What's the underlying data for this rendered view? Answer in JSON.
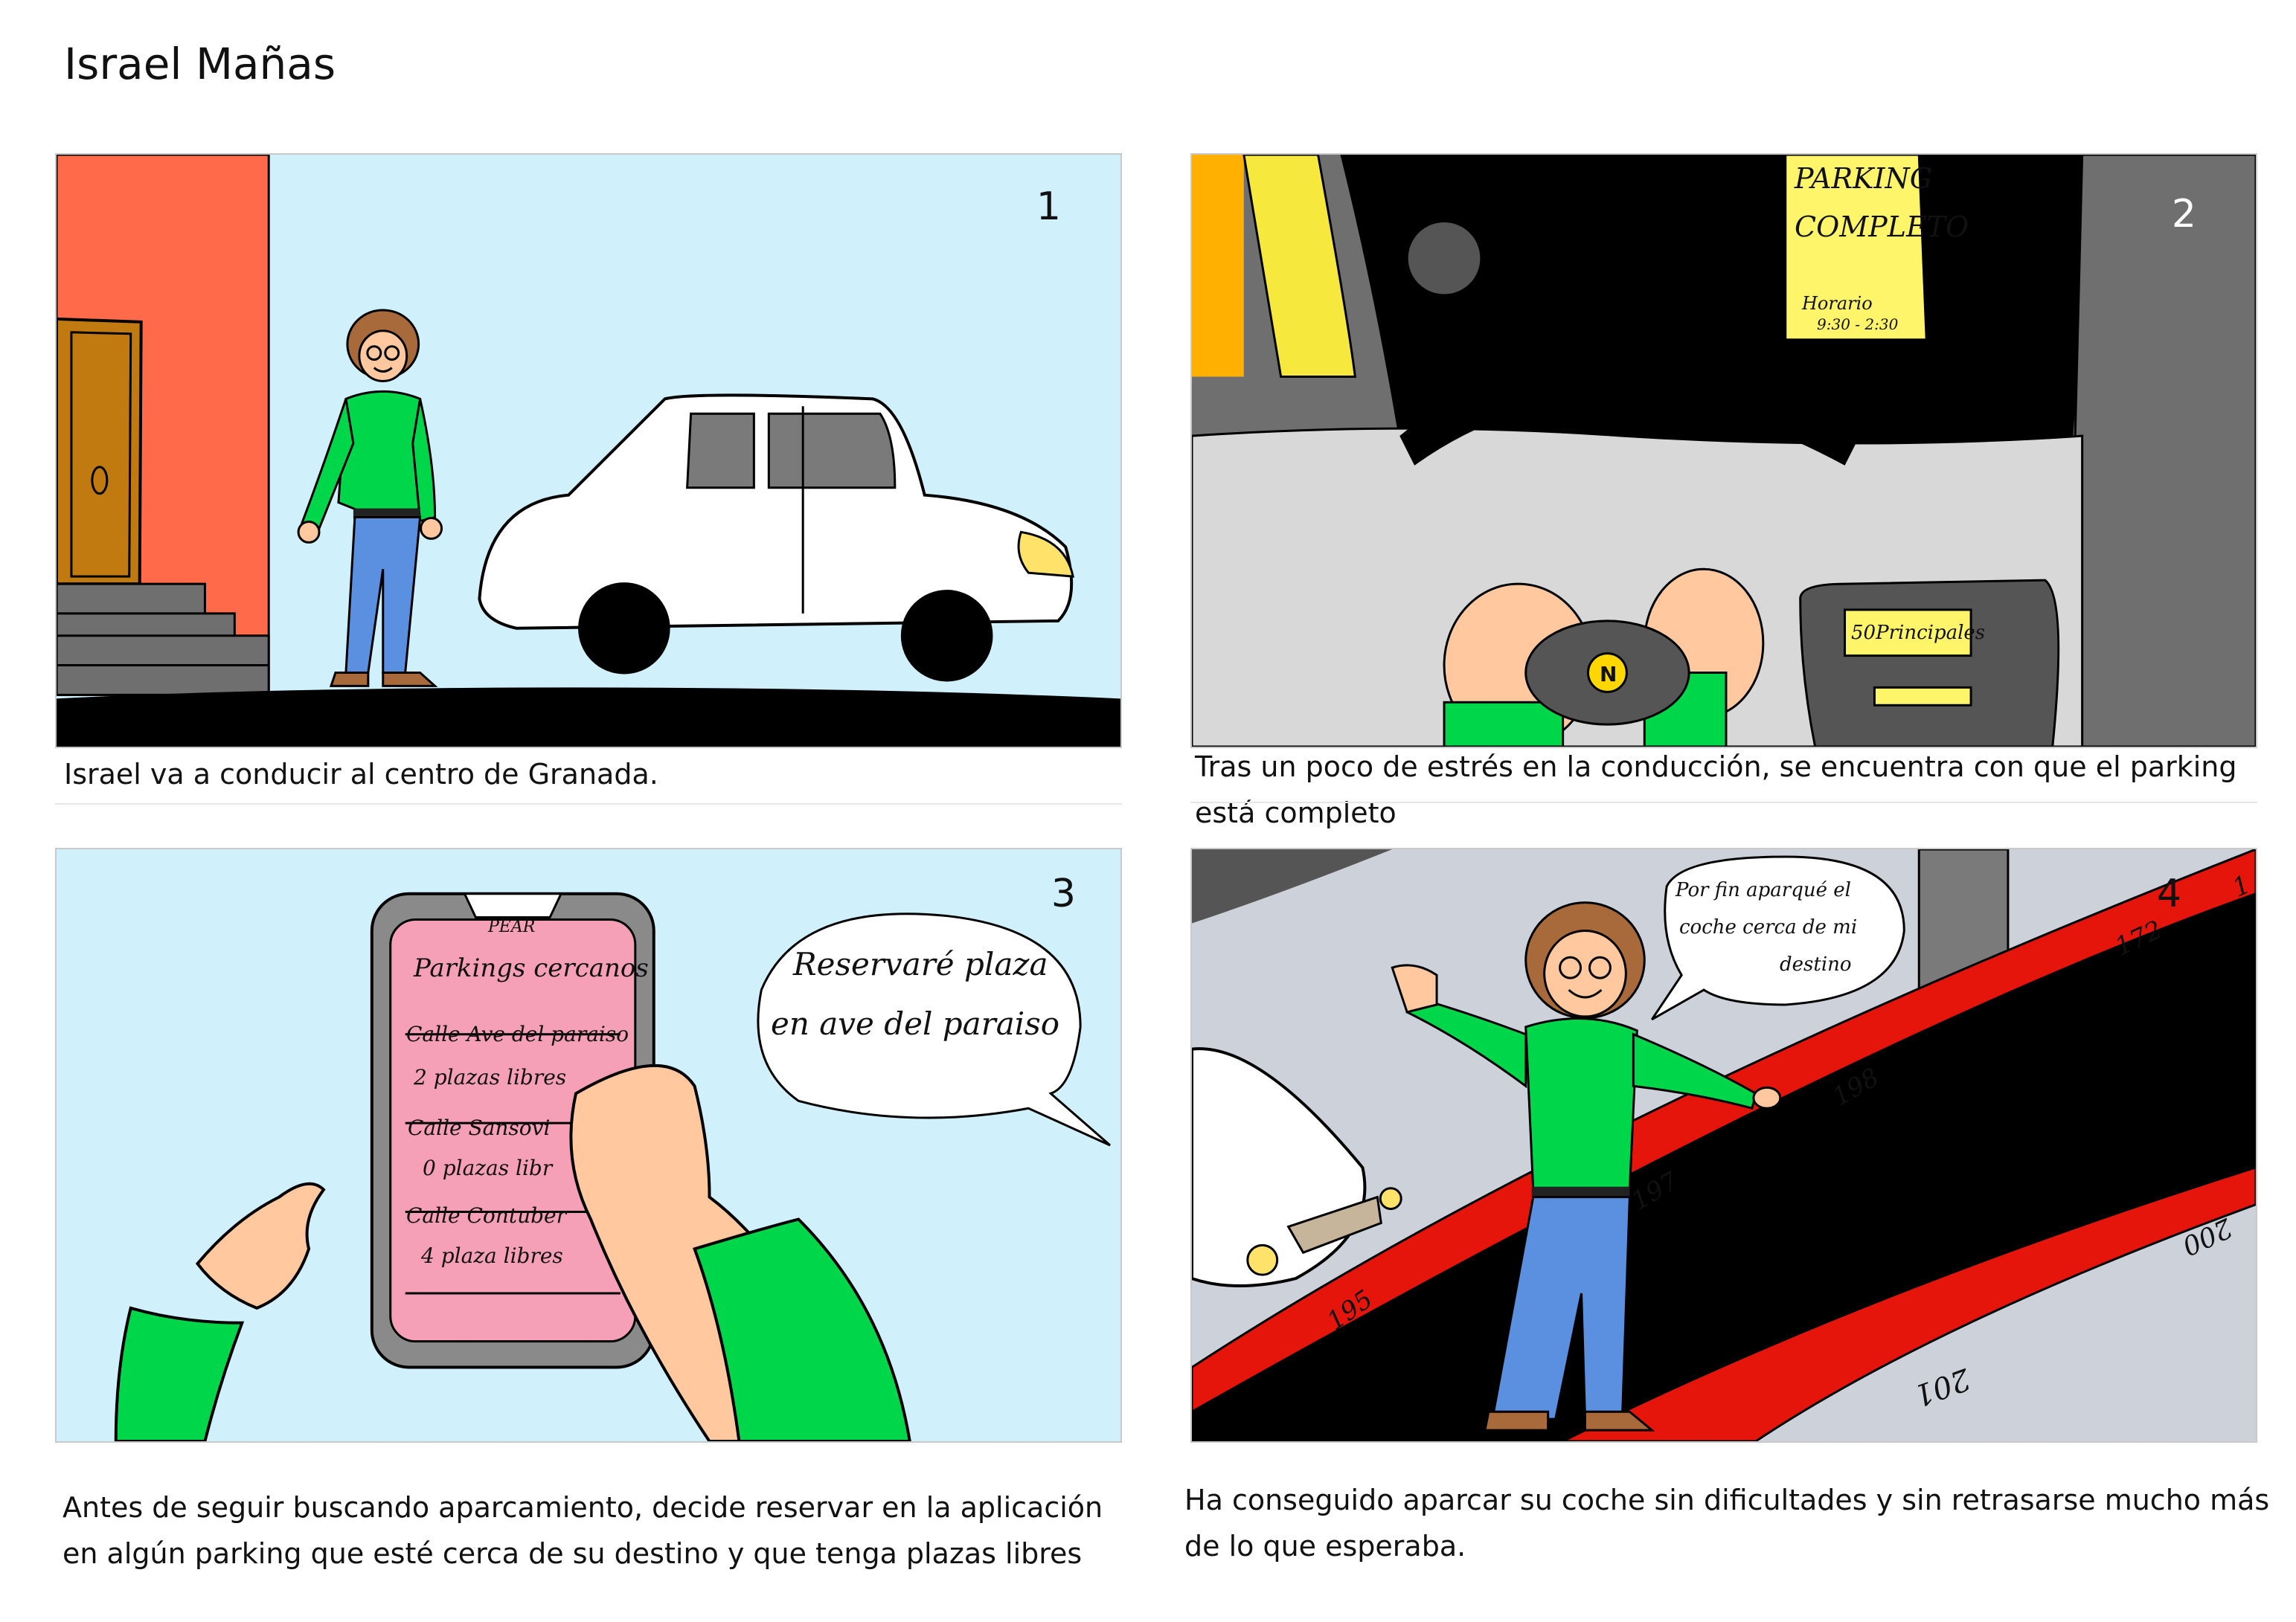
{
  "author": "Israel Mañas",
  "panels": [
    {
      "number": "1",
      "caption": "Israel va a conducir al centro de Granada."
    },
    {
      "number": "2",
      "caption": "Tras un poco de estrés en la conducción, se encuentra con que el parking está completo",
      "sign_line1": "PARKING",
      "sign_line2": "COMPLETO",
      "sign_line3": "Horario",
      "sign_line4": "9:30 - 2:30",
      "radio": "50Principales",
      "wheel_logo": "N"
    },
    {
      "number": "3",
      "caption": "Antes de seguir buscando aparcamiento, decide reservar en la aplicación en algún parking que esté cerca de su destino y que tenga plazas libres",
      "app_name": "PEAR",
      "phone_title": "Parkings cercanos",
      "phone_items": [
        {
          "street": "Calle Ave del paraiso",
          "spaces": "2 plazas libres"
        },
        {
          "street": "Calle Sansovi",
          "spaces": "0 plazas libr"
        },
        {
          "street": "Calle Contuber",
          "spaces": "4 plaza libres"
        }
      ],
      "speech_line1": "Reservaré plaza",
      "speech_line2": "en ave del paraiso"
    },
    {
      "number": "4",
      "caption": "Ha conseguido aparcar su coche sin dificultades y sin retrasarse mucho más de lo que esperaba.",
      "speech_line1": "Por fin aparqué el",
      "speech_line2": "coche cerca de mi",
      "speech_line3": "destino",
      "space_numbers": [
        "195",
        "197",
        "198",
        "172",
        "1",
        "200",
        "201"
      ]
    }
  ],
  "colors": {
    "shirt": "#00d64a",
    "jeans": "#5b8fe0",
    "sky": "#d0f1fc",
    "wall": "#ff6b4a",
    "skin": "#ffc89e",
    "hair": "#a86a3a",
    "asphalt": "#000000",
    "curb_red": "#e5150b",
    "sign_yellow": "#fff56a",
    "phone_pink": "#f6a0b8"
  }
}
